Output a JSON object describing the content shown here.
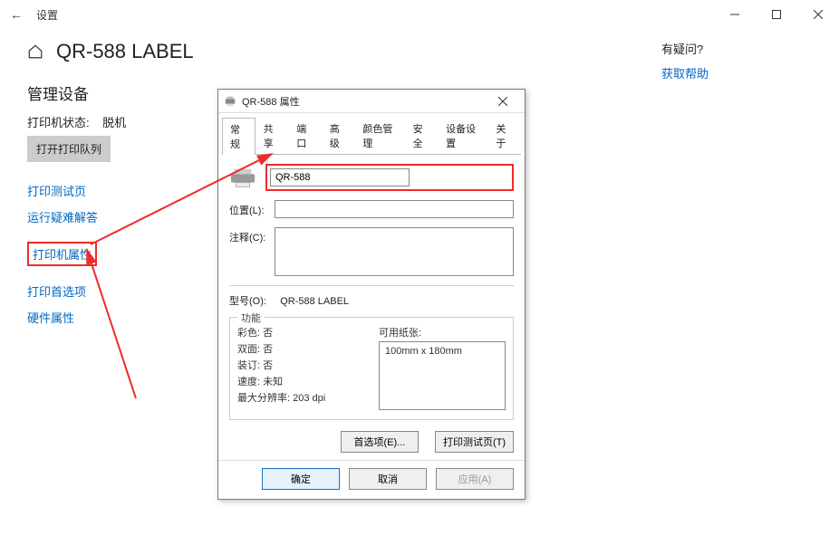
{
  "window": {
    "app_title": "设置",
    "controls": {
      "min": "min",
      "max": "max",
      "close": "close"
    }
  },
  "page": {
    "title": "QR-588 LABEL",
    "section": "管理设备",
    "status_label": "打印机状态:",
    "status_value": "脱机",
    "queue_btn": "打开打印队列",
    "links": {
      "test_page": "打印测试页",
      "troubleshoot": "运行疑难解答",
      "properties": "打印机属性",
      "preferences": "打印首选项",
      "hw_props": "硬件属性"
    }
  },
  "aside": {
    "question": "有疑问?",
    "help": "获取帮助"
  },
  "dialog": {
    "title": "QR-588 属性",
    "tabs": [
      "常规",
      "共享",
      "端口",
      "高级",
      "颜色管理",
      "安全",
      "设备设置",
      "关于"
    ],
    "name_value": "QR-588",
    "location_label": "位置(L):",
    "comment_label": "注释(C):",
    "model_label": "型号(O):",
    "model_value": "QR-588 LABEL",
    "cap_legend": "功能",
    "caps": {
      "color": "彩色: 否",
      "duplex": "双面: 否",
      "staple": "装订: 否",
      "speed": "速度: 未知",
      "maxres": "最大分辨率: 203 dpi"
    },
    "paper_legend": "可用纸张:",
    "paper_item": "100mm x 180mm",
    "prefs_btn": "首选项(E)...",
    "test_btn": "打印测试页(T)",
    "ok": "确定",
    "cancel": "取消",
    "apply": "应用(A)"
  }
}
